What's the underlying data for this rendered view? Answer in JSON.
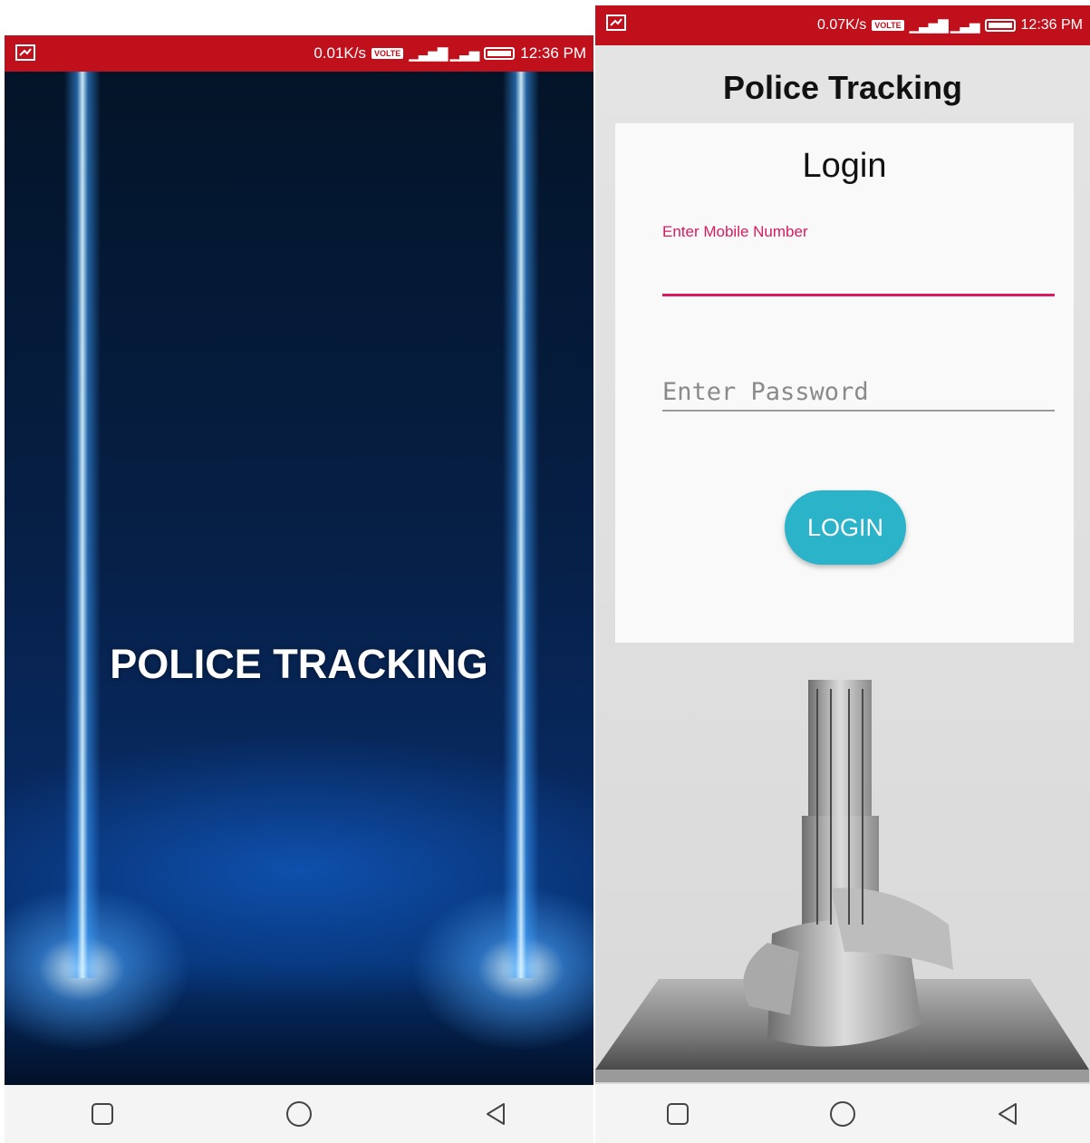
{
  "left_screen": {
    "status_bar": {
      "speed": "0.01K/s",
      "volte": "VOLTE",
      "time": "12:36 PM"
    },
    "splash_title": "POLICE TRACKING",
    "background_colors": {
      "beam": "#8fd2ff",
      "base": "#061f45"
    }
  },
  "right_screen": {
    "status_bar": {
      "speed": "0.07K/s",
      "volte": "VOLTE",
      "time": "12:36 PM"
    },
    "app_title": "Police Tracking",
    "login_card": {
      "title": "Login",
      "mobile_label": "Enter Mobile Number",
      "mobile_value": "",
      "password_placeholder": "Enter Password",
      "login_button": "LOGIN"
    },
    "accent_colors": {
      "status_bar": "#c0101c",
      "field_accent": "#d81b60",
      "button": "#2bb3c9"
    }
  },
  "nav_icons": [
    "square-recents-icon",
    "circle-home-icon",
    "triangle-back-icon"
  ]
}
